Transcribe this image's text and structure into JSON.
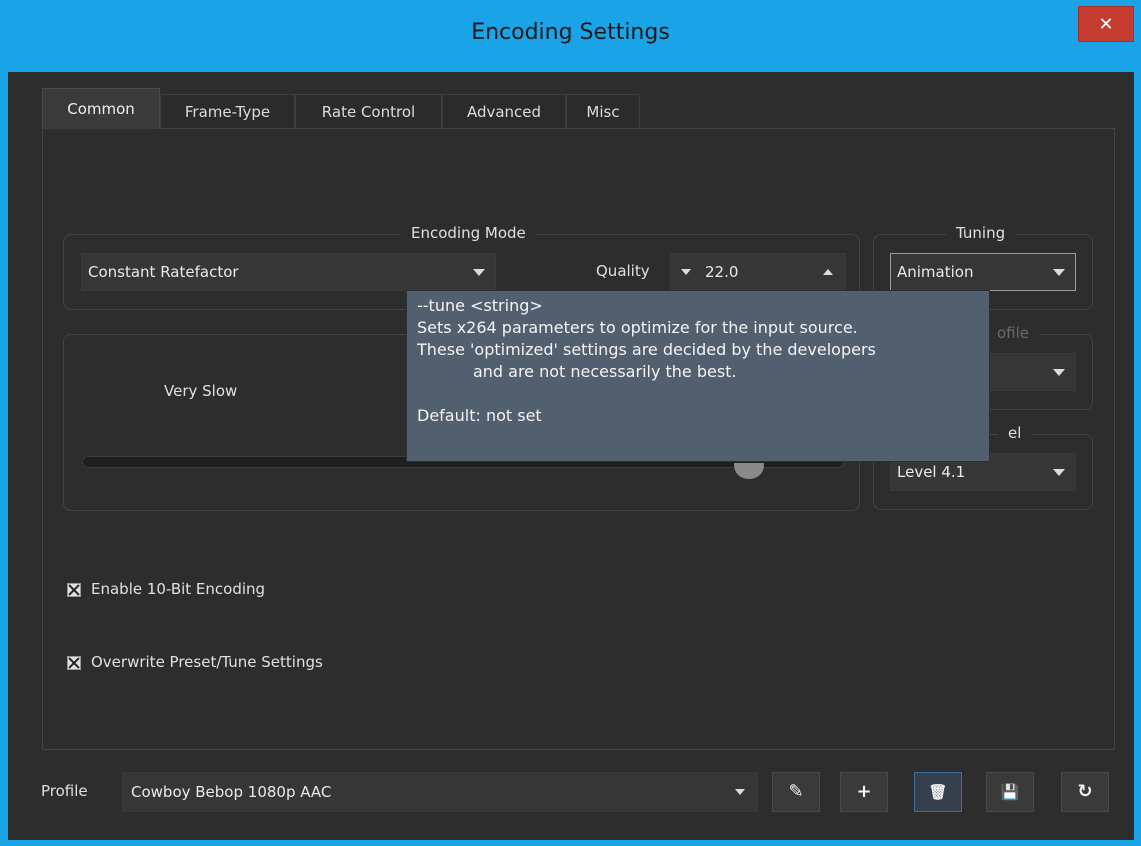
{
  "window": {
    "title": "Encoding Settings",
    "close_label": "✕"
  },
  "tabs": [
    {
      "label": "Common"
    },
    {
      "label": "Frame-Type"
    },
    {
      "label": "Rate Control"
    },
    {
      "label": "Advanced"
    },
    {
      "label": "Misc"
    }
  ],
  "encoding_mode": {
    "title": "Encoding Mode",
    "mode_value": "Constant Ratefactor",
    "quality_label": "Quality",
    "quality_value": "22.0"
  },
  "preset": {
    "value_label": "Very Slow"
  },
  "tuning": {
    "title": "Tuning",
    "value": "Animation"
  },
  "profile_group": {
    "title_fragment": "ofile"
  },
  "level_group": {
    "title_fragment": "el",
    "value": "Level 4.1"
  },
  "options": {
    "enable_10bit": {
      "label": "Enable 10-Bit Encoding",
      "checked": true
    },
    "overwrite_preset": {
      "label": "Overwrite Preset/Tune Settings",
      "checked": true
    }
  },
  "tooltip": {
    "lines": [
      "--tune <string>",
      "Sets x264 parameters to optimize for the input source.",
      "These 'optimized' settings are decided by the developers",
      "           and are not necessarily the best.",
      "",
      "Default: not set"
    ]
  },
  "profile_bar": {
    "label": "Profile",
    "value": "Cowboy Bebop 1080p AAC",
    "buttons": [
      {
        "name": "edit",
        "icon": "edit-icon",
        "glyph": "✎"
      },
      {
        "name": "add",
        "icon": "plus-icon",
        "glyph": "+"
      },
      {
        "name": "delete",
        "icon": "trash-icon",
        "glyph": "🗑"
      },
      {
        "name": "save",
        "icon": "save-icon",
        "glyph": "💾"
      },
      {
        "name": "reset",
        "icon": "reset-icon",
        "glyph": "↻"
      }
    ]
  },
  "colors": {
    "title_bar": "#1ba3e8",
    "background": "#2d2d2d",
    "tooltip_bg": "#525f6e",
    "close_button": "#c43b30"
  }
}
